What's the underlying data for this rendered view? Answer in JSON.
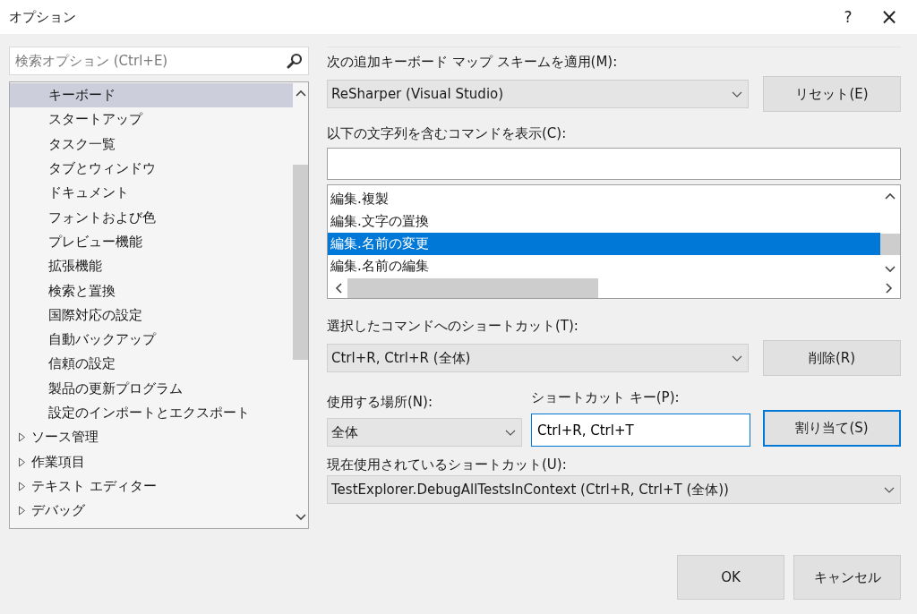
{
  "window": {
    "title": "オプション",
    "help": "?",
    "close": "×"
  },
  "search": {
    "placeholder": "検索オプション (Ctrl+E)"
  },
  "tree": {
    "items": [
      {
        "children": [
          {
            "label": "キーボード",
            "selected": true
          },
          {
            "label": "スタートアップ",
            "selected": false
          },
          {
            "label": "タスク一覧",
            "selected": false
          },
          {
            "label": "タブとウィンドウ",
            "selected": false
          },
          {
            "label": "ドキュメント",
            "selected": false
          },
          {
            "label": "フォントおよび色",
            "selected": false
          },
          {
            "label": "プレビュー機能",
            "selected": false
          },
          {
            "label": "拡張機能",
            "selected": false
          },
          {
            "label": "検索と置換",
            "selected": false
          },
          {
            "label": "国際対応の設定",
            "selected": false
          },
          {
            "label": "自動バックアップ",
            "selected": false
          },
          {
            "label": "信頼の設定",
            "selected": false
          },
          {
            "label": "製品の更新プログラム",
            "selected": false
          },
          {
            "label": "設定のインポートとエクスポート",
            "selected": false
          }
        ]
      },
      {
        "label": "ソース管理",
        "selected": false,
        "expanded": false
      },
      {
        "label": "作業項目",
        "selected": false,
        "expanded": false
      },
      {
        "label": "テキスト エディター",
        "selected": false,
        "expanded": false
      },
      {
        "label": "デバッグ",
        "selected": false,
        "expanded": false
      }
    ]
  },
  "scheme": {
    "label": "次の追加キーボード マップ スキームを適用(M):",
    "value": "ReSharper (Visual Studio)",
    "button": "リセット(E)"
  },
  "filter": {
    "label": "以下の文字列を含むコマンドを表示(C):"
  },
  "commands": [
    {
      "label": "編集.複製",
      "selected": false
    },
    {
      "label": "編集.文字の置換",
      "selected": false
    },
    {
      "label": "編集.名前の変更",
      "selected": true
    },
    {
      "label": "編集.名前の編集",
      "selected": false
    }
  ],
  "shortcuts": {
    "label": "選択したコマンドへのショートカット(T):",
    "value": "Ctrl+R, Ctrl+R (全体)",
    "button": "削除(R)"
  },
  "scope": {
    "label": "使用する場所(N):",
    "value": "全体"
  },
  "shortcut_key": {
    "label": "ショートカット キー(P):",
    "value": "Ctrl+R, Ctrl+T",
    "button": "割り当て(S)"
  },
  "current": {
    "label": "現在使用されているショートカット(U):",
    "value": "TestExplorer.DebugAllTestsInContext (Ctrl+R, Ctrl+T (全体))"
  },
  "buttons": [
    "OK",
    "キャンセル"
  ]
}
